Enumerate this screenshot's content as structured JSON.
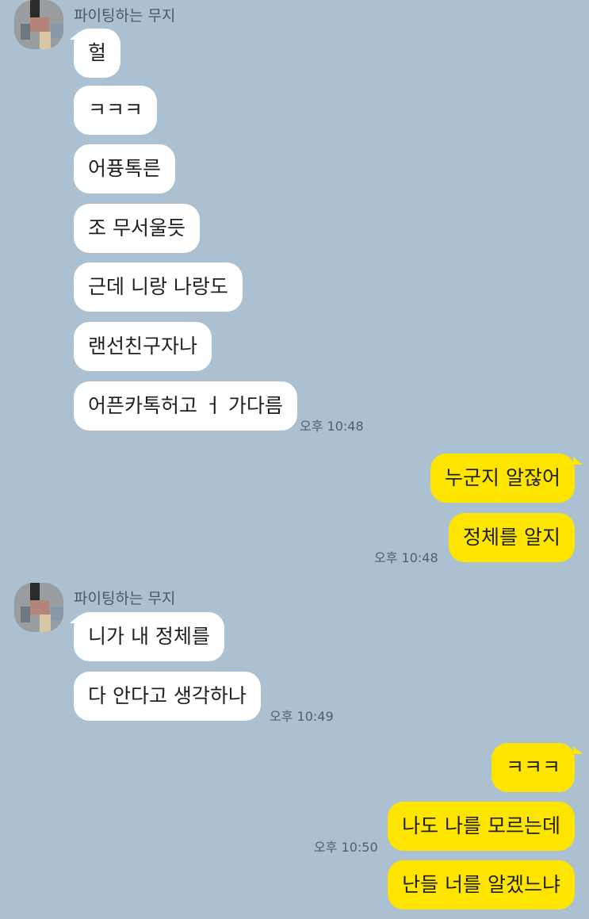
{
  "groups": [
    {
      "sender": "파이팅하는 무지",
      "messages": [
        "헐",
        "ㅋㅋㅋ",
        "어퓽톡른",
        "조 무서울듯",
        "근데 니랑 나랑도",
        "랜선친구자나",
        "어픈카톡허고 ㅓ 가다름"
      ],
      "time": "오후 10:48"
    },
    {
      "messages": [
        "누군지 알잖어",
        "정체를 알지"
      ],
      "time": "오후 10:48"
    },
    {
      "sender": "파이팅하는 무지",
      "messages": [
        "니가 내 정체를",
        "다 안다고 생각하나"
      ],
      "time": "오후 10:49"
    },
    {
      "messages": [
        "ㅋㅋㅋ",
        "나도 나를 모르는데",
        "난들 너를 알겠느냐"
      ],
      "time": "오후 10:50"
    }
  ],
  "colors": {
    "background": "#abc1d1",
    "incoming_bubble": "#ffffff",
    "outgoing_bubble": "#fee500"
  },
  "icons": {
    "avatar": "pixelated-profile-avatar"
  }
}
